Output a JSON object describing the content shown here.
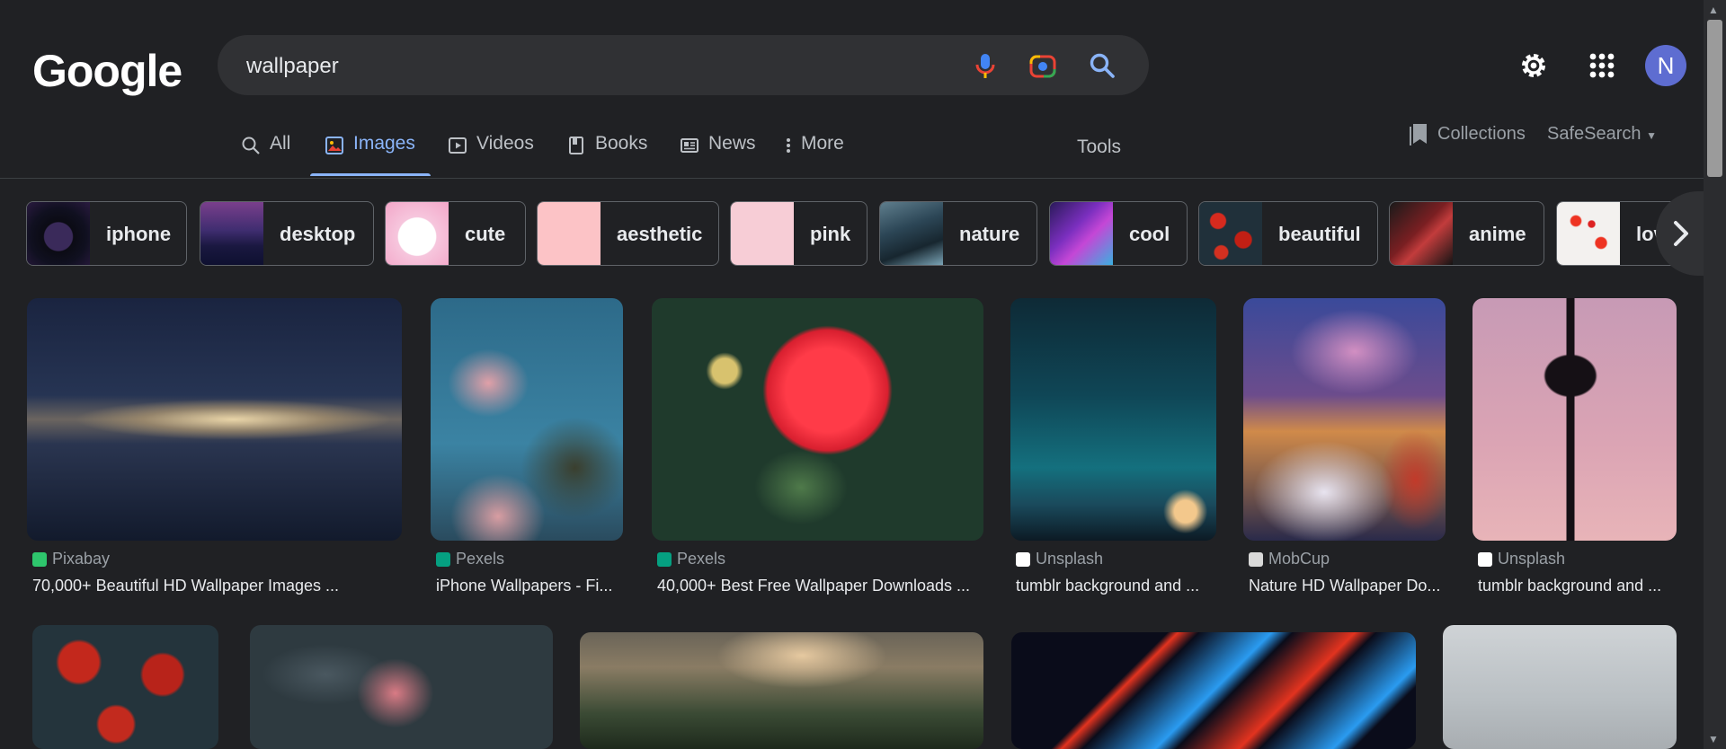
{
  "header": {
    "logo": "Google",
    "search": {
      "value": "wallpaper"
    },
    "icons": [
      "microphone-icon",
      "camera-lens-icon",
      "search-icon",
      "settings-gear-icon",
      "apps-grid-icon"
    ],
    "avatar_letter": "N"
  },
  "tabs": [
    {
      "label": "All",
      "icon": "search-icon",
      "active": false
    },
    {
      "label": "Images",
      "icon": "images-icon",
      "active": true
    },
    {
      "label": "Videos",
      "icon": "play-icon",
      "active": false
    },
    {
      "label": "Books",
      "icon": "book-icon",
      "active": false
    },
    {
      "label": "News",
      "icon": "news-icon",
      "active": false
    },
    {
      "label": "More",
      "icon": "vertical-dots-icon",
      "active": false
    }
  ],
  "tools_label": "Tools",
  "collections_label": "Collections",
  "safesearch_label": "SafeSearch",
  "chips": [
    {
      "label": "iphone"
    },
    {
      "label": "desktop"
    },
    {
      "label": "cute"
    },
    {
      "label": "aesthetic"
    },
    {
      "label": "pink"
    },
    {
      "label": "nature"
    },
    {
      "label": "cool"
    },
    {
      "label": "beautiful"
    },
    {
      "label": "anime"
    },
    {
      "label": "lov"
    }
  ],
  "results_row1": [
    {
      "source": "Pixabay",
      "favicon": "pixabay-icon",
      "title": "70,000+ Beautiful HD Wallpaper Images ..."
    },
    {
      "source": "Pexels",
      "favicon": "pexels-icon",
      "title": "iPhone Wallpapers - Fi..."
    },
    {
      "source": "Pexels",
      "favicon": "pexels-icon",
      "title": "40,000+ Best Free Wallpaper Downloads ..."
    },
    {
      "source": "Unsplash",
      "favicon": "unsplash-icon",
      "title": "tumblr background and ..."
    },
    {
      "source": "MobCup",
      "favicon": "mobcup-icon",
      "title": "Nature HD Wallpaper Do..."
    },
    {
      "source": "Unsplash",
      "favicon": "unsplash-icon",
      "title": "tumblr background and ..."
    }
  ],
  "colors": {
    "background": "#202124",
    "accent": "#8ab4f8",
    "search_bg": "#303134",
    "avatar": "#5e6dd1"
  }
}
